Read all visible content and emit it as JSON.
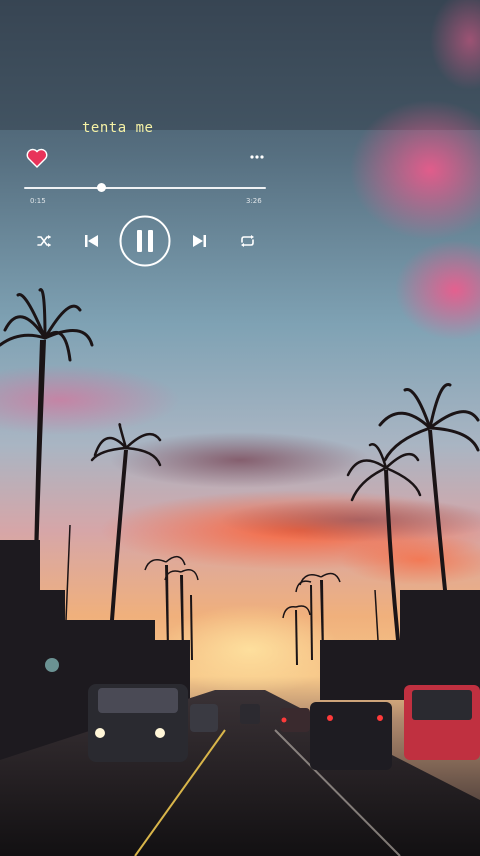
{
  "player": {
    "song_title": "tenta me",
    "time_elapsed": "0:15",
    "time_total": "3:26",
    "progress_fraction": 0.32,
    "liked": true,
    "state": "playing"
  },
  "icons": {
    "heart": "heart-icon",
    "more": "more-options-icon",
    "shuffle": "shuffle-icon",
    "previous": "skip-previous-icon",
    "play_pause": "pause-icon",
    "next": "skip-next-icon",
    "repeat": "repeat-icon"
  },
  "colors": {
    "heart": "#e8335a",
    "title": "#f6f2a6",
    "controls": "#ffffff"
  },
  "background": {
    "description_icon": "sunset-street-palm-trees-image"
  }
}
